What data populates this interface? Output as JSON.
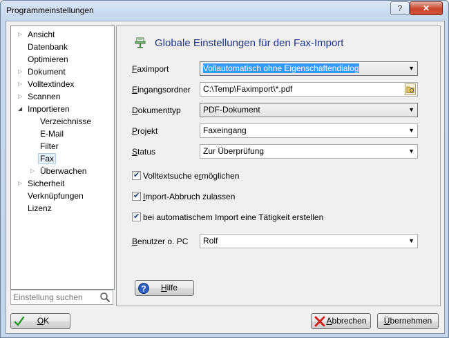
{
  "window": {
    "title": "Programmeinstellungen",
    "help_button": "?",
    "close_button": "✕"
  },
  "tree": {
    "items": [
      {
        "label": "Ansicht",
        "expander": "▷"
      },
      {
        "label": "Datenbank",
        "expander": ""
      },
      {
        "label": "Optimieren",
        "expander": ""
      },
      {
        "label": "Dokument",
        "expander": "▷"
      },
      {
        "label": "Volltextindex",
        "expander": "▷"
      },
      {
        "label": "Scannen",
        "expander": "▷"
      },
      {
        "label": "Importieren",
        "expander": "◢"
      },
      {
        "label": "Verzeichnisse",
        "expander": ""
      },
      {
        "label": "E-Mail",
        "expander": ""
      },
      {
        "label": "Filter",
        "expander": ""
      },
      {
        "label": "Fax",
        "expander": ""
      },
      {
        "label": "Überwachen",
        "expander": "▷"
      },
      {
        "label": "Sicherheit",
        "expander": "▷"
      },
      {
        "label": "Verknüpfungen",
        "expander": ""
      },
      {
        "label": "Lizenz",
        "expander": ""
      }
    ]
  },
  "search": {
    "placeholder": "Einstellung suchen"
  },
  "panel": {
    "title": "Globale Einstellungen für den Fax-Import",
    "fields": {
      "faximport": {
        "label_u": "F",
        "label_rest": "aximport",
        "value": "Vollautomatisch ohne Eigenschaftendialog"
      },
      "eingangsordner": {
        "label_u": "E",
        "label_rest": "ingangsordner",
        "value": "C:\\Temp\\Faximport\\*.pdf"
      },
      "dokumenttyp": {
        "label_u": "D",
        "label_rest": "okumenttyp",
        "value": "PDF-Dokument"
      },
      "projekt": {
        "label_u": "P",
        "label_rest": "rojekt",
        "value": "Faxeingang"
      },
      "status": {
        "label_u": "S",
        "label_rest": "tatus",
        "value": "Zur Überprüfung"
      },
      "benutzer": {
        "label_u": "B",
        "label_rest": "enutzer o. PC",
        "value": "Rolf"
      }
    },
    "checks": [
      {
        "pre": "Volltextsuche e",
        "u": "r",
        "post": "möglichen",
        "checked": true
      },
      {
        "pre": "",
        "u": "I",
        "post": "mport-Abbruch zulassen",
        "checked": true
      },
      {
        "pre": "bei automatischem Import eine Tätigkeit erstellen",
        "u": "",
        "post": "",
        "checked": true
      }
    ],
    "help_button": {
      "pre": "",
      "u": "H",
      "post": "ilfe"
    }
  },
  "footer": {
    "ok": {
      "pre": "",
      "u": "O",
      "post": "K"
    },
    "cancel": {
      "pre": "",
      "u": "A",
      "post": "bbrechen"
    },
    "apply": {
      "pre": "",
      "u": "Ü",
      "post": "bernehmen"
    }
  },
  "colors": {
    "title": "#1e3287",
    "accent": "#3399ff"
  }
}
